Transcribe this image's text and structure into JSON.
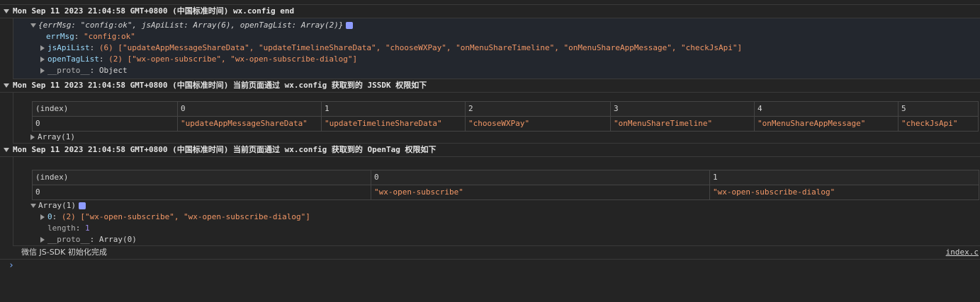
{
  "groups": [
    {
      "header": "Mon Sep 11 2023 21:04:58 GMT+0800 (中国标准时间) wx.config end",
      "summary": "{errMsg: \"config:ok\", jsApiList: Array(6), openTagList: Array(2)}",
      "lines": {
        "errMsg_key": "errMsg",
        "errMsg_val": "\"config:ok\"",
        "jsApiList_key": "jsApiList",
        "jsApiList_val": "(6) [\"updateAppMessageShareData\", \"updateTimelineShareData\", \"chooseWXPay\", \"onMenuShareTimeline\", \"onMenuShareAppMessage\", \"checkJsApi\"]",
        "openTagList_key": "openTagList",
        "openTagList_val": "(2) [\"wx-open-subscribe\", \"wx-open-subscribe-dialog\"]",
        "proto_key": "__proto__",
        "proto_val": "Object"
      }
    },
    {
      "header": "Mon Sep 11 2023 21:04:58 GMT+0800 (中国标准时间) 当前页面通过 wx.config 获取到的 JSSDK 权限如下",
      "table": {
        "headers": [
          "(index)",
          "0",
          "1",
          "2",
          "3",
          "4",
          "5"
        ],
        "rows": [
          [
            "0",
            "\"updateAppMessageShareData\"",
            "\"updateTimelineShareData\"",
            "\"chooseWXPay\"",
            "\"onMenuShareTimeline\"",
            "\"onMenuShareAppMessage\"",
            "\"checkJsApi\""
          ]
        ]
      },
      "footer": "Array(1)"
    },
    {
      "header": "Mon Sep 11 2023 21:04:58 GMT+0800 (中国标准时间) 当前页面通过 wx.config 获取到的 OpenTag 权限如下",
      "table": {
        "headers": [
          "(index)",
          "0",
          "1"
        ],
        "rows": [
          [
            "0",
            "\"wx-open-subscribe\"",
            "\"wx-open-subscribe-dialog\""
          ]
        ]
      },
      "footer": "Array(1)",
      "expanded": {
        "item0_key": "0",
        "item0_val": "(2) [\"wx-open-subscribe\", \"wx-open-subscribe-dialog\"]",
        "length_key": "length",
        "length_val": "1",
        "proto_key": "__proto__",
        "proto_val": "Array(0)"
      }
    }
  ],
  "status": {
    "message": "微信 JS-SDK 初始化完成",
    "link": "index.c"
  },
  "prompt_symbol": "›",
  "colors": {
    "background": "#242424",
    "string": "#f29766",
    "key": "#9cdcfe",
    "number": "#9e8eed"
  }
}
